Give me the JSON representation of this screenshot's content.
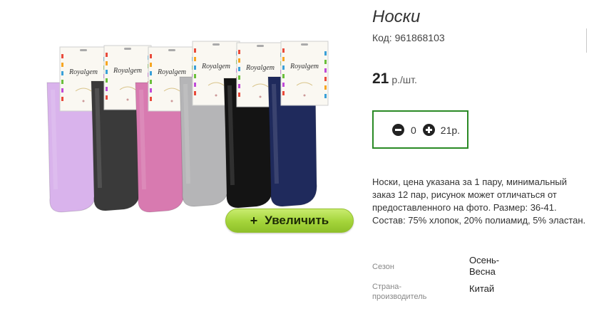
{
  "product": {
    "title": "Носки",
    "code_label": "Код:",
    "code_value": "961868103",
    "price_value": "21",
    "price_unit": "р./шт."
  },
  "quantity": {
    "value": "0",
    "total": "21р."
  },
  "gallery": {
    "zoom_label": "Увеличить",
    "zoom_plus": "+",
    "brand_text": "Royalgem",
    "sock_colors": [
      "#d9b3ec",
      "#3a3a3a",
      "#d87ab0",
      "#b5b5b7",
      "#141414",
      "#1f2a5c"
    ]
  },
  "description": "Носки, цена указана за 1 пару, минимальный заказ 12 пар, рисунок может отличаться от предоставленного на фото. Размер: 36-41. Состав: 75% хлопок, 20% полиамид, 5% эластан.",
  "specs": [
    {
      "label": "Сезон",
      "value": "Осень-\nВесна"
    },
    {
      "label": "Страна-\nпроизводитель",
      "value": "Китай"
    }
  ],
  "colors": {
    "qty_border": "#2a8a25",
    "zoom_button": "#a4d43a"
  }
}
